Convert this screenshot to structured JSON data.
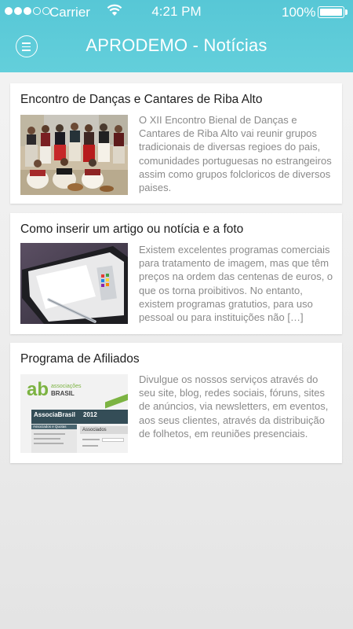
{
  "status_bar": {
    "carrier": "Carrier",
    "time": "4:21 PM",
    "battery": "100%"
  },
  "header": {
    "title": "APRODEMO - Notícias",
    "menu_icon": "hamburger-menu-icon"
  },
  "news": [
    {
      "title": "Encontro de Danças e Cantares de Riba Alto",
      "excerpt": "O XII Encontro Bienal de Danças e Cantares de Riba Alto vai reunir grupos tradicionais de diversas regioes do pais, comunidades portuguesas no estrangeiros assim como grupos folcloricos de diversos paises.",
      "image": "folk-dancers-photo"
    },
    {
      "title": "Como inserir um artigo ou notícia e a foto",
      "excerpt": "Existem excelentes programas comerciais para tratamento de imagem, mas que têm preços na ordem das centenas de euros, o que os torna proibitivos. No entanto, existem programas gratutios, para uso pessoal ou para instituições não […]",
      "image": "tablet-stylus-photo"
    },
    {
      "title": "Programa de Afiliados",
      "excerpt": "Divulgue os nossos serviços através do seu site, blog, redes sociais, fóruns, sites de anúncios, via newsletters, em eventos, aos seus clientes, através da distribuição de folhetos, em reuniões presenciais.",
      "image": "associacoes-brasil-screenshot",
      "image_text": {
        "logo_mark": "ab",
        "logo_top": "associações",
        "logo_bottom": "BRASIL",
        "site_name": "AssociaBrasil",
        "year": "2012",
        "menu_head": "Associados e Quotas",
        "section": "Associados"
      }
    }
  ],
  "colors": {
    "header": "#5ccad8",
    "card_title": "#1e1e1e",
    "card_text": "#8a8a8a",
    "logo_green": "#7cb342"
  }
}
